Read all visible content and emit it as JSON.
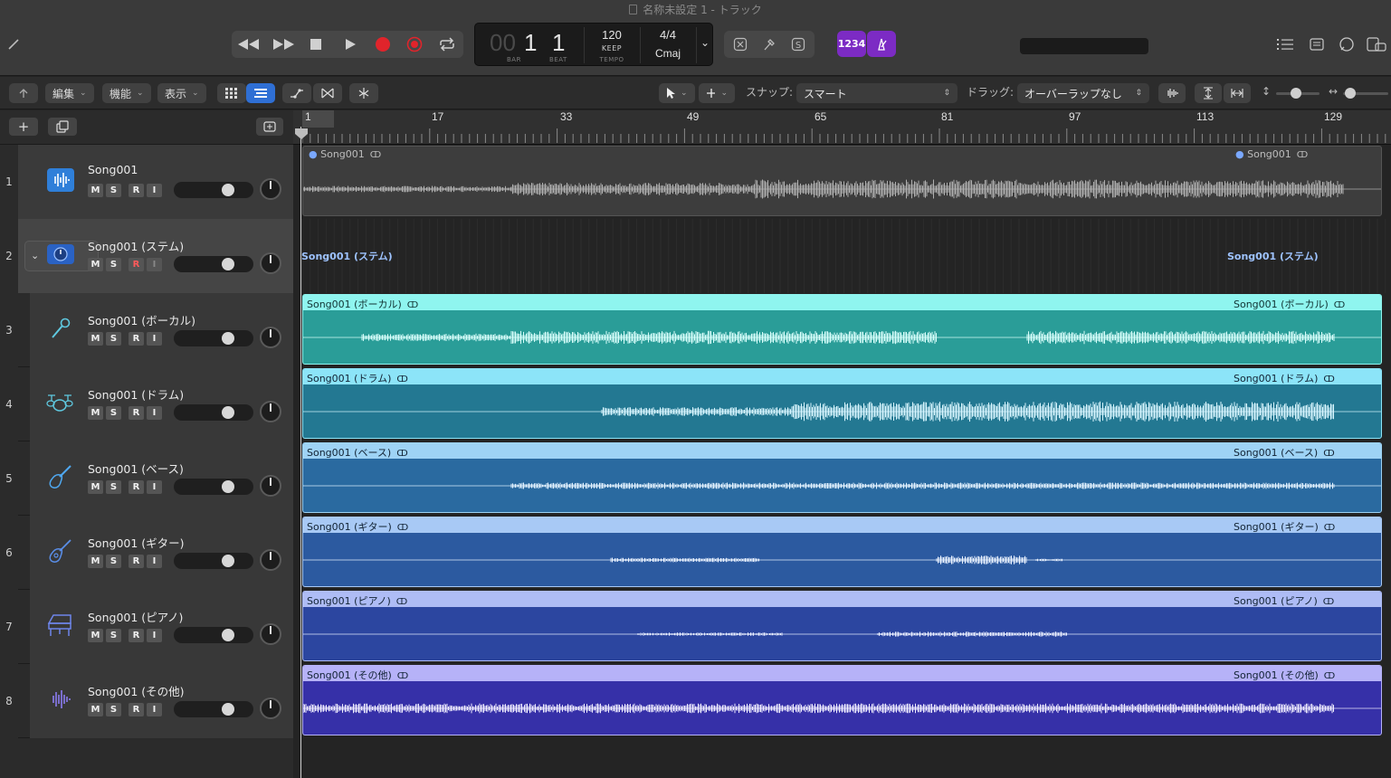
{
  "window": {
    "title": "名称未設定 1 - トラック"
  },
  "transport": {
    "position_bar_dim": "00",
    "position_bar": "1",
    "position_beat": "1",
    "bar_label": "BAR",
    "beat_label": "BEAT",
    "tempo": "120",
    "tempo_mode": "KEEP",
    "tempo_label": "TEMPO",
    "signature": "4/4",
    "key": "Cmaj",
    "count_in_label": "1234"
  },
  "toolbar": {
    "edit": "編集",
    "functions": "機能",
    "view": "表示",
    "snap_label": "スナップ:",
    "snap_value": "スマート",
    "drag_label": "ドラッグ:",
    "drag_value": "オーバーラップなし"
  },
  "ruler": {
    "bars": [
      "1",
      "17",
      "33",
      "49",
      "65",
      "81",
      "97",
      "113",
      "129"
    ]
  },
  "tracks": [
    {
      "num": "1",
      "name": "Song001",
      "icon": "waveform-icon",
      "region": "Song001",
      "region_end": "Song001"
    },
    {
      "num": "2",
      "name": "Song001 (ステム)",
      "icon": "stack-folder-icon",
      "region": "Song001 (ステム)",
      "region_end": "Song001 (ステム)"
    },
    {
      "num": "3",
      "name": "Song001 (ボーカル)",
      "icon": "microphone-icon",
      "region": "Song001 (ボーカル)",
      "region_end": "Song001 (ボーカル)"
    },
    {
      "num": "4",
      "name": "Song001 (ドラム)",
      "icon": "drum-kit-icon",
      "region": "Song001 (ドラム)",
      "region_end": "Song001 (ドラム)"
    },
    {
      "num": "5",
      "name": "Song001 (ベース)",
      "icon": "bass-guitar-icon",
      "region": "Song001 (ベース)",
      "region_end": "Song001 (ベース)"
    },
    {
      "num": "6",
      "name": "Song001 (ギター)",
      "icon": "guitar-icon",
      "region": "Song001 (ギター)",
      "region_end": "Song001 (ギター)"
    },
    {
      "num": "7",
      "name": "Song001 (ピアノ)",
      "icon": "piano-icon",
      "region": "Song001 (ピアノ)",
      "region_end": "Song001 (ピアノ)"
    },
    {
      "num": "8",
      "name": "Song001 (その他)",
      "icon": "other-waveform-icon",
      "region": "Song001 (その他)",
      "region_end": "Song001 (その他)"
    }
  ],
  "track_buttons": {
    "mute": "M",
    "solo": "S",
    "record": "R",
    "input": "I"
  },
  "colors": {
    "track1": "#3d3d3d",
    "vocal": "#2a9d98",
    "vocal_head": "#8ff5ef",
    "drums": "#237892",
    "drums_head": "#8ce4f8",
    "bass": "#2a6aa0",
    "bass_head": "#9ed3f5",
    "guitar": "#2c5aa0",
    "guitar_head": "#a8c9f5",
    "piano": "#2c46a0",
    "piano_head": "#aebcf5",
    "other": "#3630a8",
    "other_head": "#b6b2f8",
    "record": "#e0242b",
    "count_in": "#7c2bc4"
  }
}
